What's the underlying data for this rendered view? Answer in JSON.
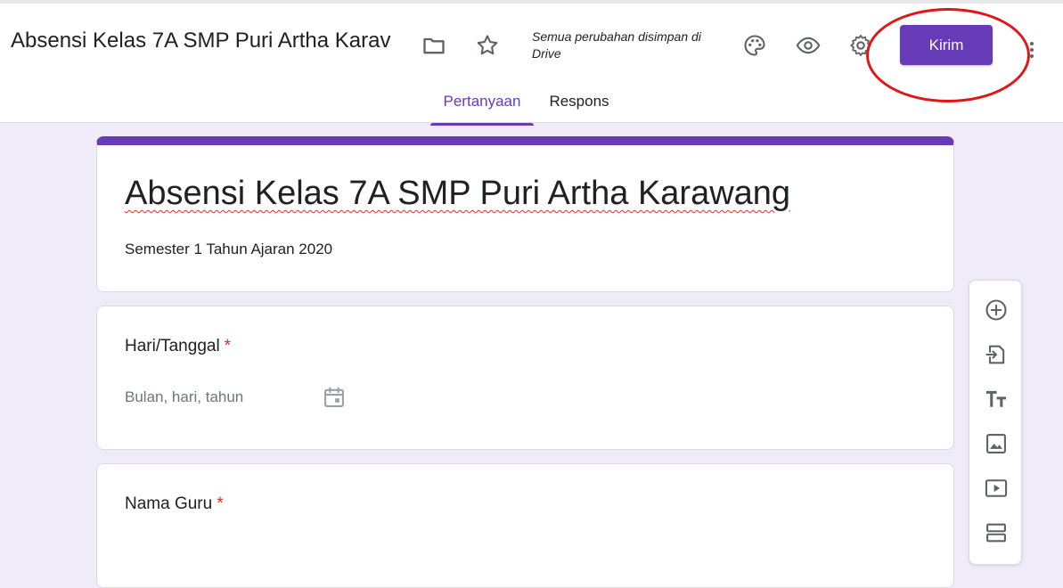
{
  "header": {
    "doc_title": "Absensi Kelas 7A SMP Puri Artha Karav",
    "saved_status": "Semua perubahan disimpan di Drive",
    "send_label": "Kirim",
    "icons": [
      "folder-icon",
      "star-icon",
      "palette-icon",
      "eye-icon",
      "gear-icon",
      "more-vertical-icon"
    ]
  },
  "tabs": [
    {
      "label": "Pertanyaan",
      "active": true
    },
    {
      "label": "Respons",
      "active": false
    }
  ],
  "form": {
    "title": "Absensi Kelas 7A SMP Puri Artha Karawang",
    "description": "Semester 1 Tahun Ajaran 2020"
  },
  "questions": [
    {
      "title": "Hari/Tanggal",
      "required_mark": "*",
      "placeholder": "Bulan, hari, tahun"
    },
    {
      "title": "Nama Guru",
      "required_mark": "*"
    }
  ],
  "toolbar": {
    "icons": [
      "add-circle-icon",
      "import-icon",
      "title-text-icon",
      "image-icon",
      "video-icon",
      "section-icon"
    ]
  },
  "colors": {
    "accent": "#673ab7",
    "background": "#f0ebf8",
    "required": "#d93025",
    "annotation": "#e01717"
  }
}
